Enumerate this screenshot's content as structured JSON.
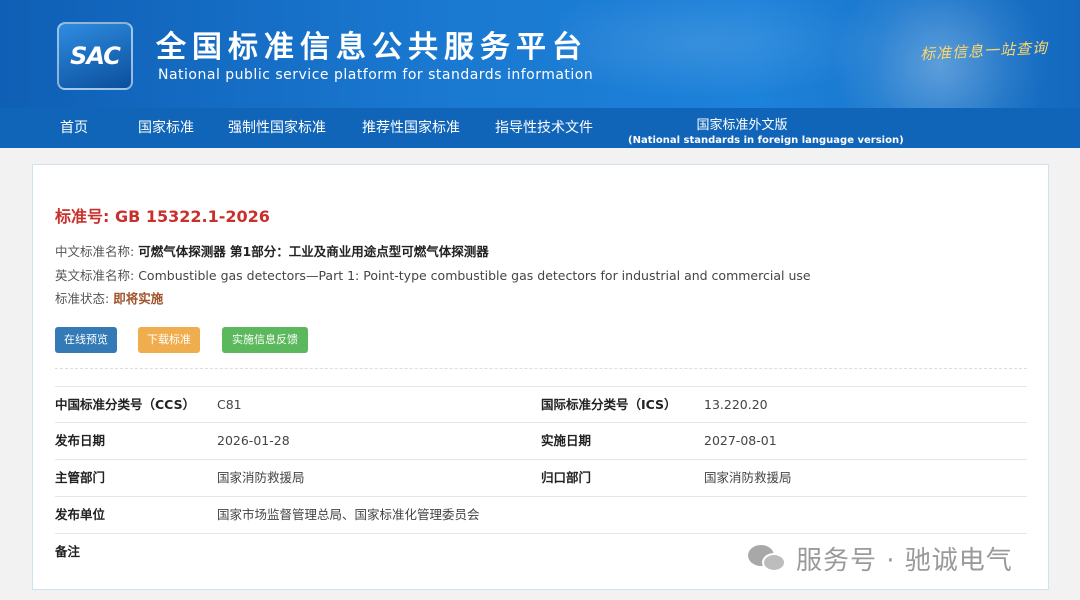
{
  "header": {
    "logo_text": "SAC",
    "title_cn": "全国标准信息公共服务平台",
    "title_en": "National public service platform  for standards information",
    "slogan": "标准信息一站查询"
  },
  "nav": {
    "items": [
      "首页",
      "国家标准",
      "强制性国家标准",
      "推荐性国家标准",
      "指导性技术文件"
    ],
    "foreign_cn": "国家标准外文版",
    "foreign_en": "(National standards in foreign language version)"
  },
  "standard": {
    "no_label": "标准号:",
    "no_value": "GB 15322.1-2026",
    "cn_name_label": "中文标准名称:",
    "cn_name": "可燃气体探测器 第1部分：工业及商业用途点型可燃气体探测器",
    "en_name_label": "英文标准名称:",
    "en_name": "Combustible gas detectors—Part 1: Point-type combustible gas detectors for industrial and commercial use",
    "status_label": "标准状态:",
    "status": "即将实施"
  },
  "buttons": {
    "preview": "在线预览",
    "download": "下载标准",
    "feedback": "实施信息反馈"
  },
  "details": {
    "ccs_label": "中国标准分类号（CCS）",
    "ccs_value": "C81",
    "ics_label": "国际标准分类号（ICS）",
    "ics_value": "13.220.20",
    "pub_date_label": "发布日期",
    "pub_date": "2026-01-28",
    "impl_date_label": "实施日期",
    "impl_date": "2027-08-01",
    "dept_label": "主管部门",
    "dept_value": "国家消防救援局",
    "central_label": "归口部门",
    "central_value": "国家消防救援局",
    "publisher_label": "发布单位",
    "publisher_value": "国家市场监督管理总局、国家标准化管理委员会",
    "remarks_label": "备注",
    "remarks_value": ""
  },
  "watermark": {
    "text": "服务号 · 驰诚电气"
  }
}
